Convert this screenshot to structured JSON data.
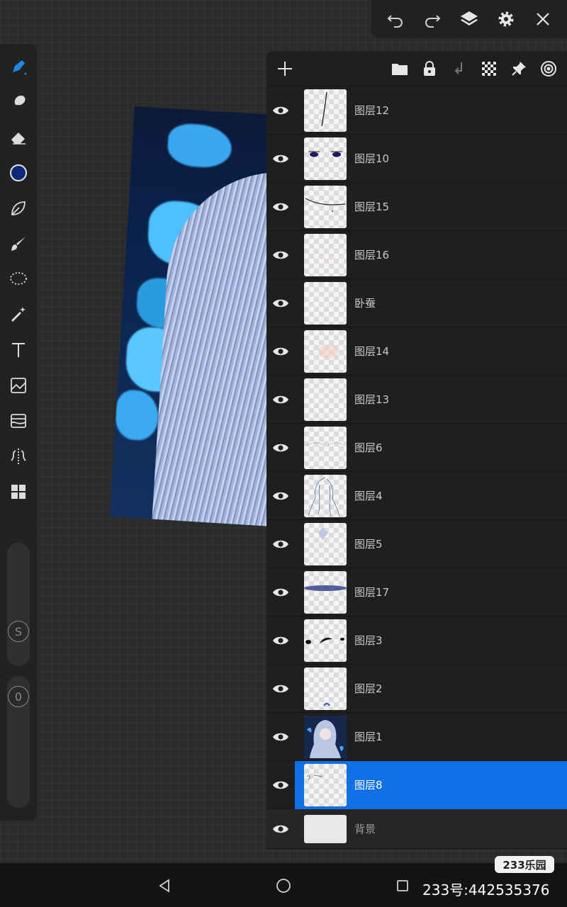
{
  "colors": {
    "accent": "#1270e6",
    "active_tool": "#1e88e5",
    "brush_color": "#0d2a78",
    "panel_bg": "#1f1f1f",
    "canvas_bg": "#2b2b2b"
  },
  "top_bar": {
    "icons": [
      "undo-icon",
      "redo-icon",
      "layers-icon",
      "gear-icon",
      "close-icon"
    ]
  },
  "toolbar": {
    "tools": [
      "pen-icon",
      "smudge-icon",
      "eraser-icon",
      "color-icon",
      "leaf-icon",
      "brush-icon",
      "lasso-icon",
      "magic-wand-icon",
      "text-icon",
      "image-icon",
      "filter-icon",
      "symmetry-icon",
      "grid-icon"
    ],
    "size_slider_label": "S",
    "opacity_slider_label": "0"
  },
  "layers_panel": {
    "header_icons": [
      "add-icon",
      "folder-icon",
      "lock-icon",
      "merge-down-icon",
      "transparency-icon",
      "pin-icon",
      "target-icon"
    ],
    "layers": [
      {
        "name": "图层12",
        "visible": true,
        "selected": false
      },
      {
        "name": "图层10",
        "visible": true,
        "selected": false
      },
      {
        "name": "图层15",
        "visible": true,
        "selected": false
      },
      {
        "name": "图层16",
        "visible": true,
        "selected": false
      },
      {
        "name": "卧蚕",
        "visible": true,
        "selected": false
      },
      {
        "name": "图层14",
        "visible": true,
        "selected": false
      },
      {
        "name": "图层13",
        "visible": true,
        "selected": false
      },
      {
        "name": "图层6",
        "visible": true,
        "selected": false
      },
      {
        "name": "图层4",
        "visible": true,
        "selected": false
      },
      {
        "name": "图层5",
        "visible": true,
        "selected": false
      },
      {
        "name": "图层17",
        "visible": true,
        "selected": false
      },
      {
        "name": "图层3",
        "visible": true,
        "selected": false
      },
      {
        "name": "图层2",
        "visible": true,
        "selected": false
      },
      {
        "name": "图层1",
        "visible": true,
        "selected": false
      },
      {
        "name": "图层8",
        "visible": true,
        "selected": true
      },
      {
        "name": "背景",
        "visible": true,
        "selected": false
      }
    ]
  },
  "watermark": {
    "logo": "233乐园",
    "id_text": "233号:442535376"
  }
}
